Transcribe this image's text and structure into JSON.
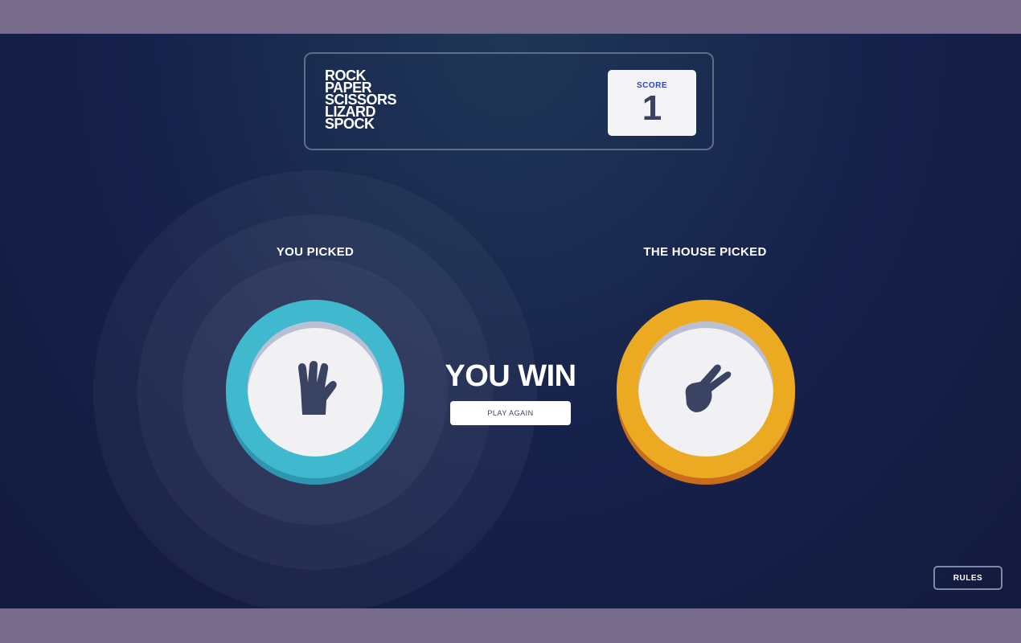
{
  "header": {
    "title_lines": [
      "ROCK",
      "PAPER",
      "SCISSORS",
      "LIZARD",
      "SPOCK"
    ],
    "score_label": "SCORE",
    "score_value": "1"
  },
  "player": {
    "label": "YOU PICKED",
    "choice": "spock",
    "icon": "spock-hand-icon",
    "color": "#40b9ce"
  },
  "house": {
    "label": "THE HOUSE PICKED",
    "choice": "scissors",
    "icon": "scissors-hand-icon",
    "color": "#eca922"
  },
  "result": {
    "text": "YOU WIN",
    "play_again_label": "PLAY AGAIN"
  },
  "rules_label": "RULES"
}
